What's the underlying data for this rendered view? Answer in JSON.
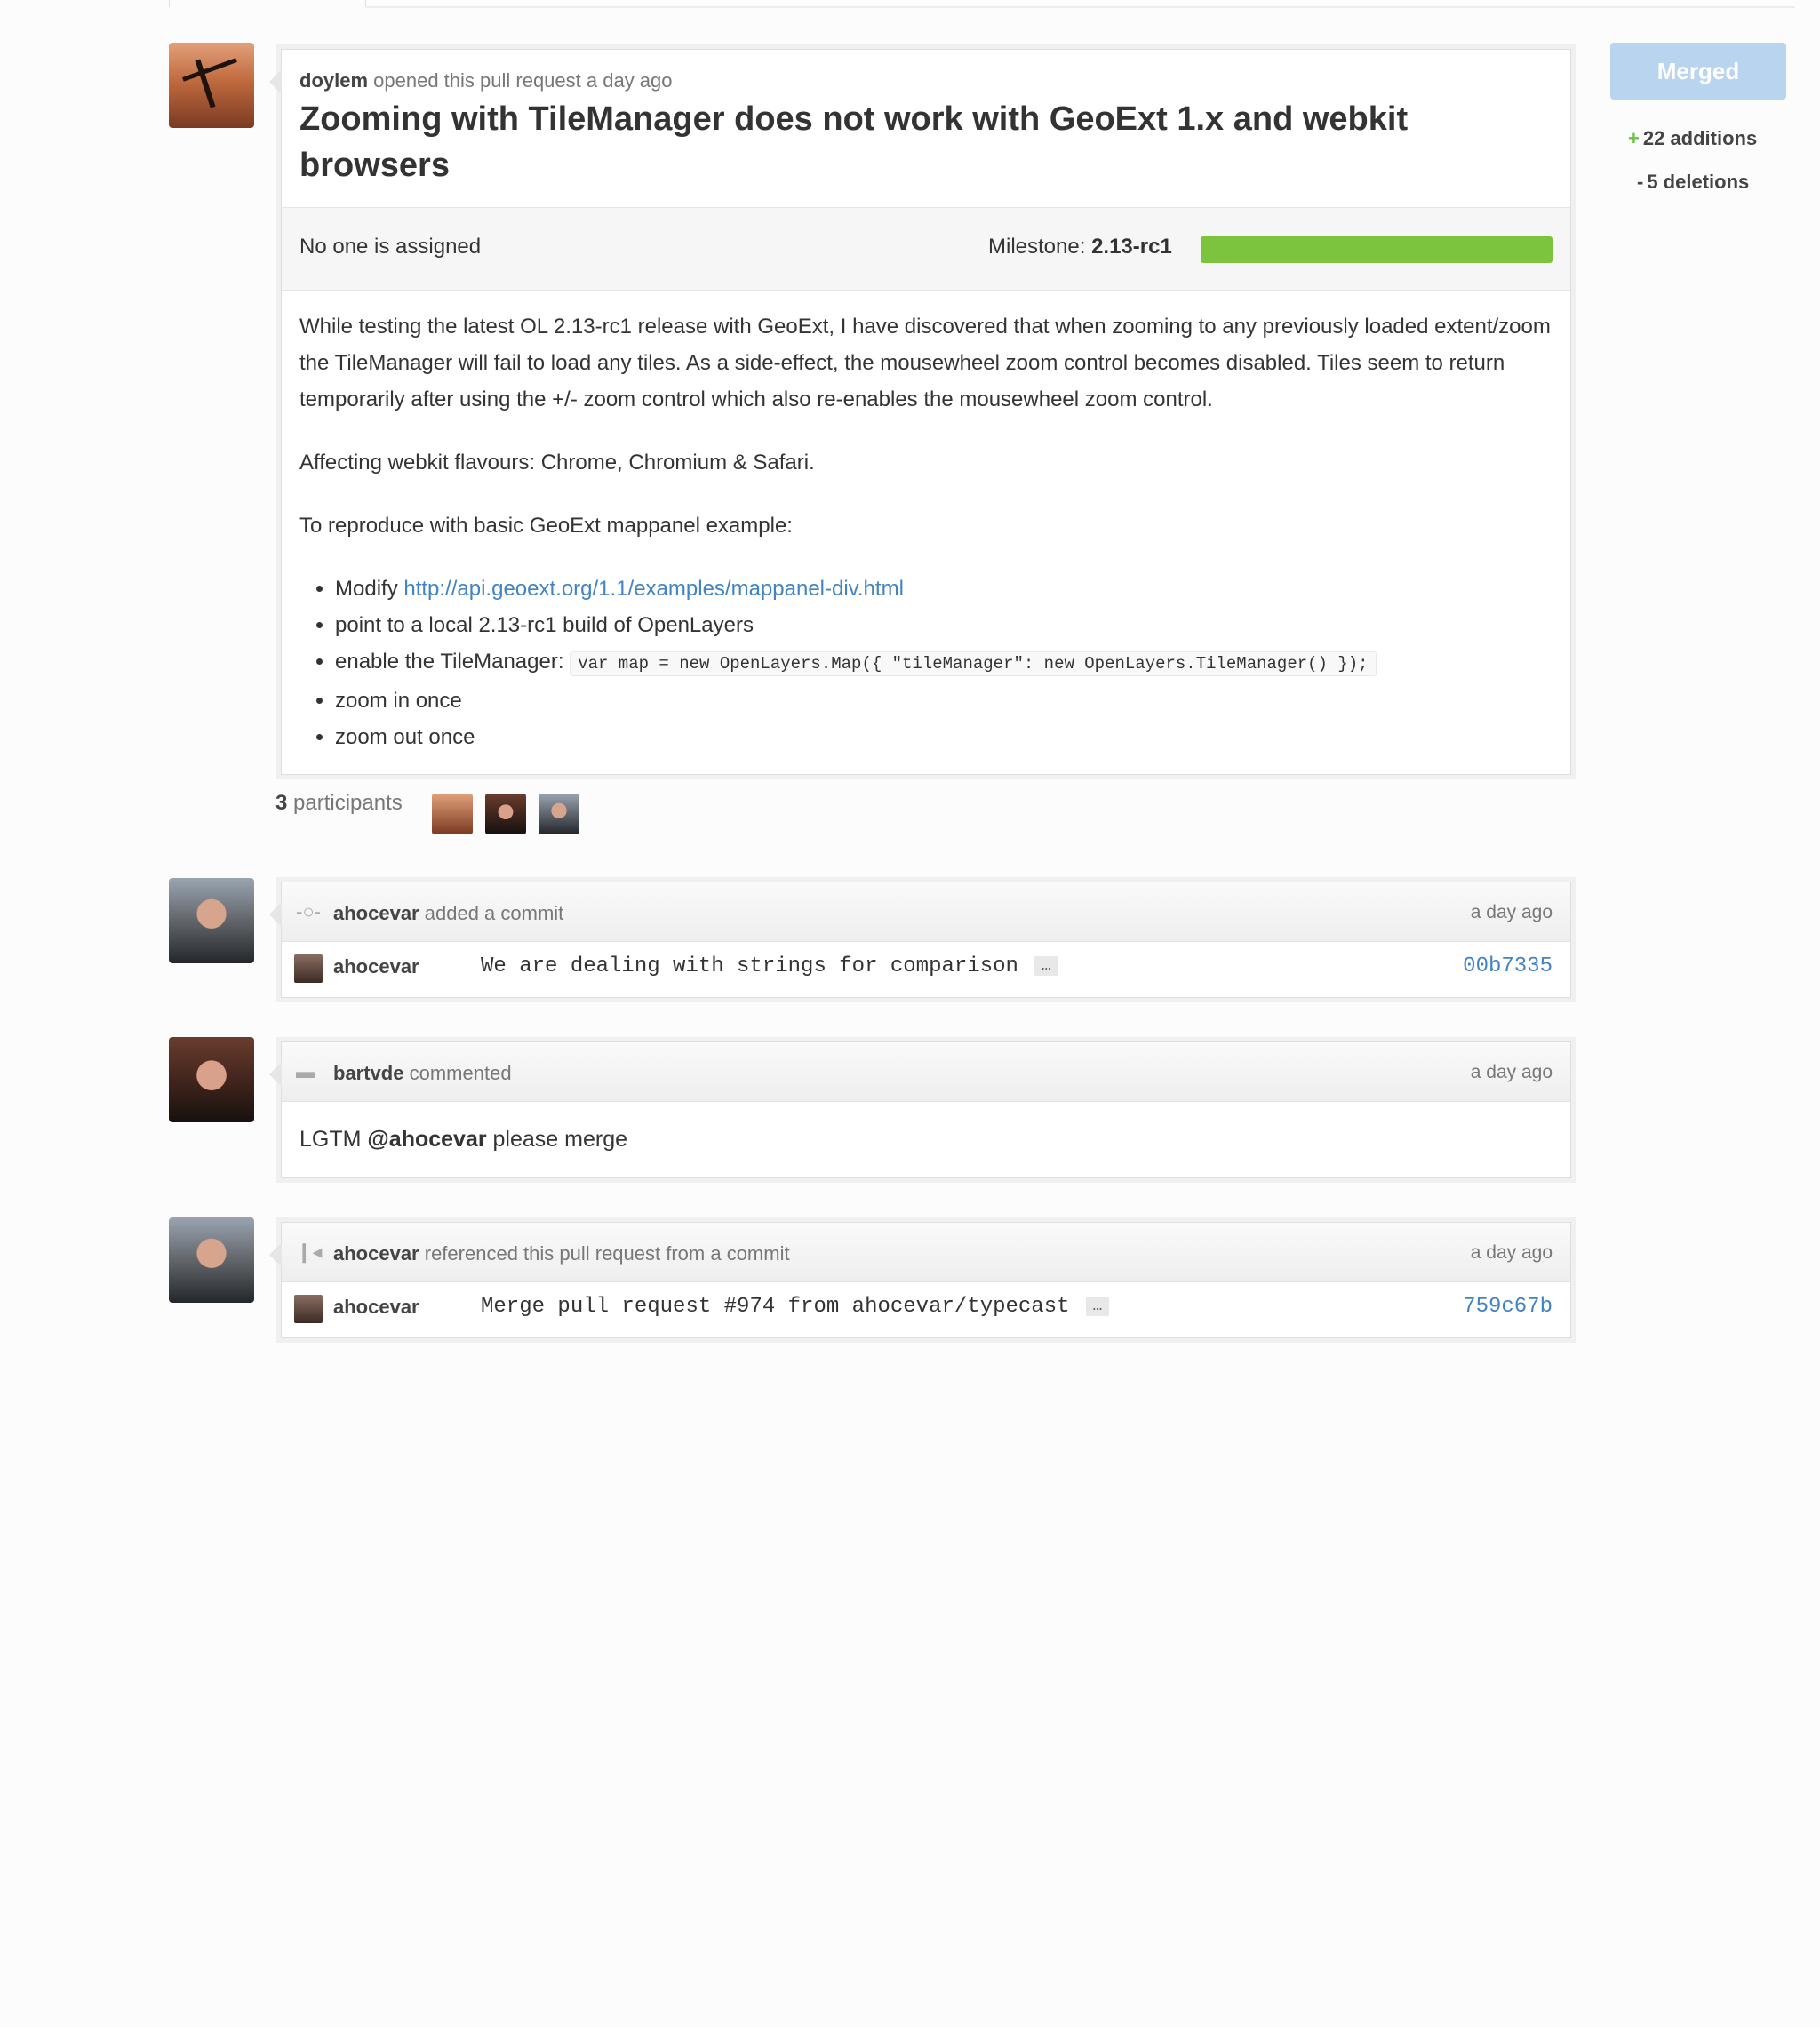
{
  "pr": {
    "opener_user": "doylem",
    "opener_text": "opened this pull request a day ago",
    "title": "Zooming with TileManager does not work with GeoExt 1.x and webkit browsers",
    "assignee": "No one is assigned",
    "milestone_label": "Milestone:",
    "milestone_name": "2.13-rc1",
    "milestone_progress": 1.0,
    "body_p1": "While testing the latest OL 2.13-rc1 release with GeoExt, I have discovered that when zooming to any previously loaded extent/zoom the TileManager will fail to load any tiles. As a side-effect, the mousewheel zoom control becomes disabled. Tiles seem to return temporarily after using the +/- zoom control which also re-enables the mousewheel zoom control.",
    "body_p2": "Affecting webkit flavours: Chrome, Chromium & Safari.",
    "body_p3": "To reproduce with basic GeoExt mappanel example:",
    "list": {
      "item1_prefix": "Modify",
      "item1_link": "http://api.geoext.org/1.1/examples/mappanel-div.html",
      "item2": "point to a local 2.13-rc1 build of OpenLayers",
      "item3_prefix": "enable the TileManager:",
      "item3_code": "var map = new OpenLayers.Map({ \"tileManager\": new OpenLayers.TileManager() });",
      "item4": "zoom in once",
      "item5": "zoom out once"
    }
  },
  "participants": {
    "count": "3",
    "label": "participants"
  },
  "events": {
    "commit1": {
      "user": "ahocevar",
      "action": "added a commit",
      "time": "a day ago",
      "author": "ahocevar",
      "message": "We are dealing with strings for comparison",
      "more": "…",
      "sha": "00b7335"
    },
    "comment": {
      "user": "bartvde",
      "action": "commented",
      "time": "a day ago",
      "body_prefix": "LGTM",
      "mention": "@ahocevar",
      "body_suffix": "please merge"
    },
    "reference": {
      "user": "ahocevar",
      "action": "referenced this pull request from a commit",
      "time": "a day ago",
      "author": "ahocevar",
      "message": "Merge pull request #974 from ahocevar/typecast",
      "more": "…",
      "sha": "759c67b"
    }
  },
  "sidebar": {
    "status": "Merged",
    "additions": "22 additions",
    "deletions": "5 deletions"
  },
  "icons": {
    "commit": "commit-icon",
    "comment": "comment-icon",
    "reference": "reference-icon"
  }
}
